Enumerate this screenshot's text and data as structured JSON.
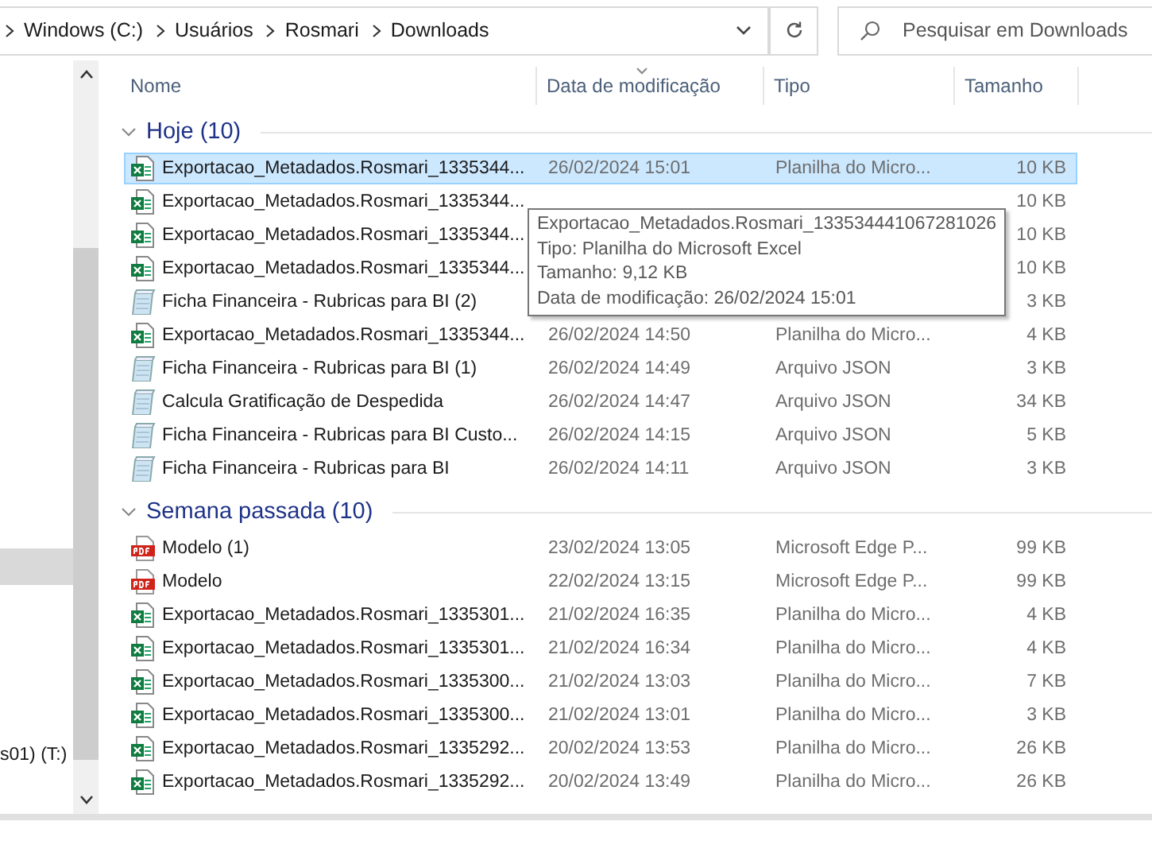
{
  "address_bar": {
    "path": [
      "Windows (C:)",
      "Usuários",
      "Rosmari",
      "Downloads"
    ]
  },
  "search": {
    "placeholder": "Pesquisar em Downloads"
  },
  "navigation_pane": {
    "items": [
      {
        "label": "s01) (T:)"
      }
    ]
  },
  "columns": [
    "Nome",
    "Data de modificação",
    "Tipo",
    "Tamanho"
  ],
  "groups": [
    {
      "title": "Hoje (10)",
      "expanded": true,
      "rows": [
        {
          "kind": "excel",
          "name": "Exportacao_Metadados.Rosmari_1335344...",
          "date": "26/02/2024 15:01",
          "type": "Planilha do Micro...",
          "size": "10 KB",
          "selected": true
        },
        {
          "kind": "excel",
          "name": "Exportacao_Metadados.Rosmari_1335344...",
          "size": "10 KB",
          "selected": false
        },
        {
          "kind": "excel",
          "name": "Exportacao_Metadados.Rosmari_1335344...",
          "size": "10 KB",
          "selected": false
        },
        {
          "kind": "excel",
          "name": "Exportacao_Metadados.Rosmari_1335344...",
          "size": "10 KB",
          "selected": false
        },
        {
          "kind": "json",
          "name": "Ficha Financeira - Rubricas para BI (2)",
          "size": "3 KB",
          "selected": false
        },
        {
          "kind": "excel",
          "name": "Exportacao_Metadados.Rosmari_1335344...",
          "date": "26/02/2024 14:50",
          "type": "Planilha do Micro...",
          "size": "4 KB",
          "selected": false
        },
        {
          "kind": "json",
          "name": "Ficha Financeira - Rubricas para BI (1)",
          "date": "26/02/2024 14:49",
          "type": "Arquivo JSON",
          "size": "3 KB",
          "selected": false
        },
        {
          "kind": "json",
          "name": "Calcula Gratificação de Despedida",
          "date": "26/02/2024 14:47",
          "type": "Arquivo JSON",
          "size": "34 KB",
          "selected": false
        },
        {
          "kind": "json",
          "name": "Ficha Financeira - Rubricas para BI Custo...",
          "date": "26/02/2024 14:15",
          "type": "Arquivo JSON",
          "size": "5 KB",
          "selected": false
        },
        {
          "kind": "json",
          "name": "Ficha Financeira - Rubricas para BI",
          "date": "26/02/2024 14:11",
          "type": "Arquivo JSON",
          "size": "3 KB",
          "selected": false
        }
      ]
    },
    {
      "title": "Semana passada (10)",
      "expanded": true,
      "rows": [
        {
          "kind": "pdf",
          "name": "Modelo (1)",
          "date": "23/02/2024 13:05",
          "type": "Microsoft Edge P...",
          "size": "99 KB",
          "selected": false
        },
        {
          "kind": "pdf",
          "name": "Modelo",
          "date": "22/02/2024 13:15",
          "type": "Microsoft Edge P...",
          "size": "99 KB",
          "selected": false
        },
        {
          "kind": "excel",
          "name": "Exportacao_Metadados.Rosmari_1335301...",
          "date": "21/02/2024 16:35",
          "type": "Planilha do Micro...",
          "size": "4 KB",
          "selected": false
        },
        {
          "kind": "excel",
          "name": "Exportacao_Metadados.Rosmari_1335301...",
          "date": "21/02/2024 16:34",
          "type": "Planilha do Micro...",
          "size": "4 KB",
          "selected": false
        },
        {
          "kind": "excel",
          "name": "Exportacao_Metadados.Rosmari_1335300...",
          "date": "21/02/2024 13:03",
          "type": "Planilha do Micro...",
          "size": "7 KB",
          "selected": false
        },
        {
          "kind": "excel",
          "name": "Exportacao_Metadados.Rosmari_1335300...",
          "date": "21/02/2024 13:01",
          "type": "Planilha do Micro...",
          "size": "3 KB",
          "selected": false
        },
        {
          "kind": "excel",
          "name": "Exportacao_Metadados.Rosmari_1335292...",
          "date": "20/02/2024 13:53",
          "type": "Planilha do Micro...",
          "size": "26 KB",
          "selected": false
        },
        {
          "kind": "excel",
          "name": "Exportacao_Metadados.Rosmari_1335292...",
          "date": "20/02/2024 13:49",
          "type": "Planilha do Micro...",
          "size": "26 KB",
          "selected": false
        }
      ]
    }
  ],
  "tooltip": {
    "lines": [
      "Exportacao_Metadados.Rosmari_133534441067281026",
      "Tipo: Planilha do Microsoft Excel",
      "Tamanho: 9,12 KB",
      "Data de modificação: 26/02/2024 15:01"
    ]
  }
}
